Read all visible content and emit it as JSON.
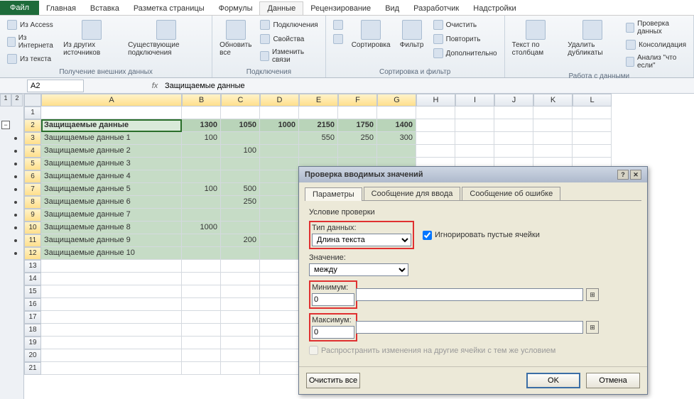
{
  "ribbon": {
    "file": "Файл",
    "tabs": [
      "Главная",
      "Вставка",
      "Разметка страницы",
      "Формулы",
      "Данные",
      "Рецензирование",
      "Вид",
      "Разработчик",
      "Надстройки"
    ],
    "active_tab": "Данные",
    "groups": {
      "external": {
        "label": "Получение внешних данных",
        "access": "Из Access",
        "web": "Из Интернета",
        "text": "Из текста",
        "other": "Из других источников",
        "existing": "Существующие подключения"
      },
      "connections": {
        "label": "Подключения",
        "refresh": "Обновить все",
        "conn": "Подключения",
        "props": "Свойства",
        "links": "Изменить связи"
      },
      "sort": {
        "label": "Сортировка и фильтр",
        "sort": "Сортировка",
        "filter": "Фильтр",
        "clear": "Очистить",
        "reapply": "Повторить",
        "advanced": "Дополнительно"
      },
      "tools": {
        "label": "Работа с данными",
        "texttocol": "Текст по столбцам",
        "dedup": "Удалить дубликаты",
        "validation": "Проверка данных",
        "consolidate": "Консолидация",
        "whatif": "Анализ \"что если\""
      }
    }
  },
  "namebox": "A2",
  "formula": "Защищаемые данные",
  "columns": [
    "A",
    "B",
    "C",
    "D",
    "E",
    "F",
    "G",
    "H",
    "I",
    "J",
    "K",
    "L"
  ],
  "outline_levels": [
    "1",
    "2"
  ],
  "rows": [
    {
      "n": 1,
      "cells": [
        "",
        "",
        "",
        "",
        "",
        "",
        "",
        "",
        "",
        "",
        "",
        ""
      ]
    },
    {
      "n": 2,
      "bold": true,
      "cells": [
        "Защищаемые данные",
        "1300",
        "1050",
        "1000",
        "2150",
        "1750",
        "1400",
        "",
        "",
        "",
        "",
        ""
      ]
    },
    {
      "n": 3,
      "cells": [
        "Защищаемые данные 1",
        "100",
        "",
        "",
        "550",
        "250",
        "300",
        "",
        "",
        "",
        "",
        ""
      ]
    },
    {
      "n": 4,
      "cells": [
        "Защищаемые данные 2",
        "",
        "100",
        "",
        "",
        "",
        "",
        "",
        "",
        "",
        "",
        ""
      ]
    },
    {
      "n": 5,
      "cells": [
        "Защищаемые данные 3",
        "",
        "",
        "",
        "",
        "",
        "",
        "",
        "",
        "",
        "",
        ""
      ]
    },
    {
      "n": 6,
      "cells": [
        "Защищаемые данные 4",
        "",
        "",
        "",
        "",
        "",
        "",
        "",
        "",
        "",
        "",
        ""
      ]
    },
    {
      "n": 7,
      "cells": [
        "Защищаемые данные 5",
        "100",
        "500",
        "",
        "",
        "",
        "",
        "",
        "",
        "",
        "",
        ""
      ]
    },
    {
      "n": 8,
      "cells": [
        "Защищаемые данные 6",
        "",
        "250",
        "",
        "",
        "",
        "",
        "",
        "",
        "",
        "",
        ""
      ]
    },
    {
      "n": 9,
      "cells": [
        "Защищаемые данные 7",
        "",
        "",
        "",
        "",
        "",
        "",
        "",
        "",
        "",
        "",
        ""
      ]
    },
    {
      "n": 10,
      "cells": [
        "Защищаемые данные 8",
        "1000",
        "",
        "",
        "",
        "",
        "",
        "",
        "",
        "",
        "",
        ""
      ]
    },
    {
      "n": 11,
      "cells": [
        "Защищаемые данные 9",
        "",
        "200",
        "",
        "",
        "",
        "",
        "",
        "",
        "",
        "",
        ""
      ]
    },
    {
      "n": 12,
      "cells": [
        "Защищаемые данные 10",
        "",
        "",
        "",
        "",
        "",
        "",
        "",
        "",
        "",
        "",
        ""
      ]
    }
  ],
  "empty_rows_start": 13,
  "empty_rows_end": 21,
  "selection": {
    "cols": [
      "A",
      "B",
      "C",
      "D",
      "E",
      "F",
      "G"
    ],
    "rows_from": 2,
    "rows_to": 12,
    "active": "A2"
  },
  "dialog": {
    "title": "Проверка вводимых значений",
    "tabs": [
      "Параметры",
      "Сообщение для ввода",
      "Сообщение об ошибке"
    ],
    "active_tab": "Параметры",
    "section": "Условие проверки",
    "type_label": "Тип данных:",
    "type_value": "Длина текста",
    "ignore_blank": "Игнорировать пустые ячейки",
    "ignore_blank_checked": true,
    "data_label": "Значение:",
    "data_value": "между",
    "min_label": "Минимум:",
    "min_value": "0",
    "max_label": "Максимум:",
    "max_value": "0",
    "apply_label": "Распространить изменения на другие ячейки с тем же условием",
    "clear": "Очистить все",
    "ok": "OK",
    "cancel": "Отмена"
  }
}
